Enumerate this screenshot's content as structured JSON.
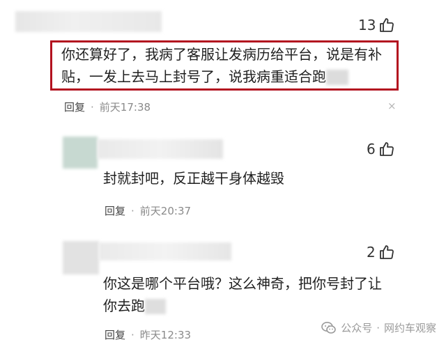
{
  "comments": [
    {
      "likes": "13",
      "text_line1": "你还算好了，我病了客服让发病历给平台，说是有补",
      "text_line2": "贴，一发上去马上封号了，说我病重适合跑",
      "reply_label": "回复",
      "dot": "·",
      "time": "前天17:38"
    },
    {
      "likes": "6",
      "text_line1": "封就封吧，反正越干身体越毁",
      "reply_label": "回复",
      "dot": "·",
      "time": "前天20:37"
    },
    {
      "likes": "2",
      "text_line1": "你这是哪个平台哦？这么神奇，把你号封了让",
      "text_line2": "你去跑",
      "reply_label": "回复",
      "dot": "·",
      "time": "昨天12:33"
    }
  ],
  "close_glyph": "×",
  "watermark": {
    "icon": "wechat-official-account-icon",
    "account_label": "公众号",
    "sep": "·",
    "name": "网约车观察"
  },
  "colors": {
    "highlight_border": "#b3121f",
    "meta_time": "#8a8a8a"
  }
}
